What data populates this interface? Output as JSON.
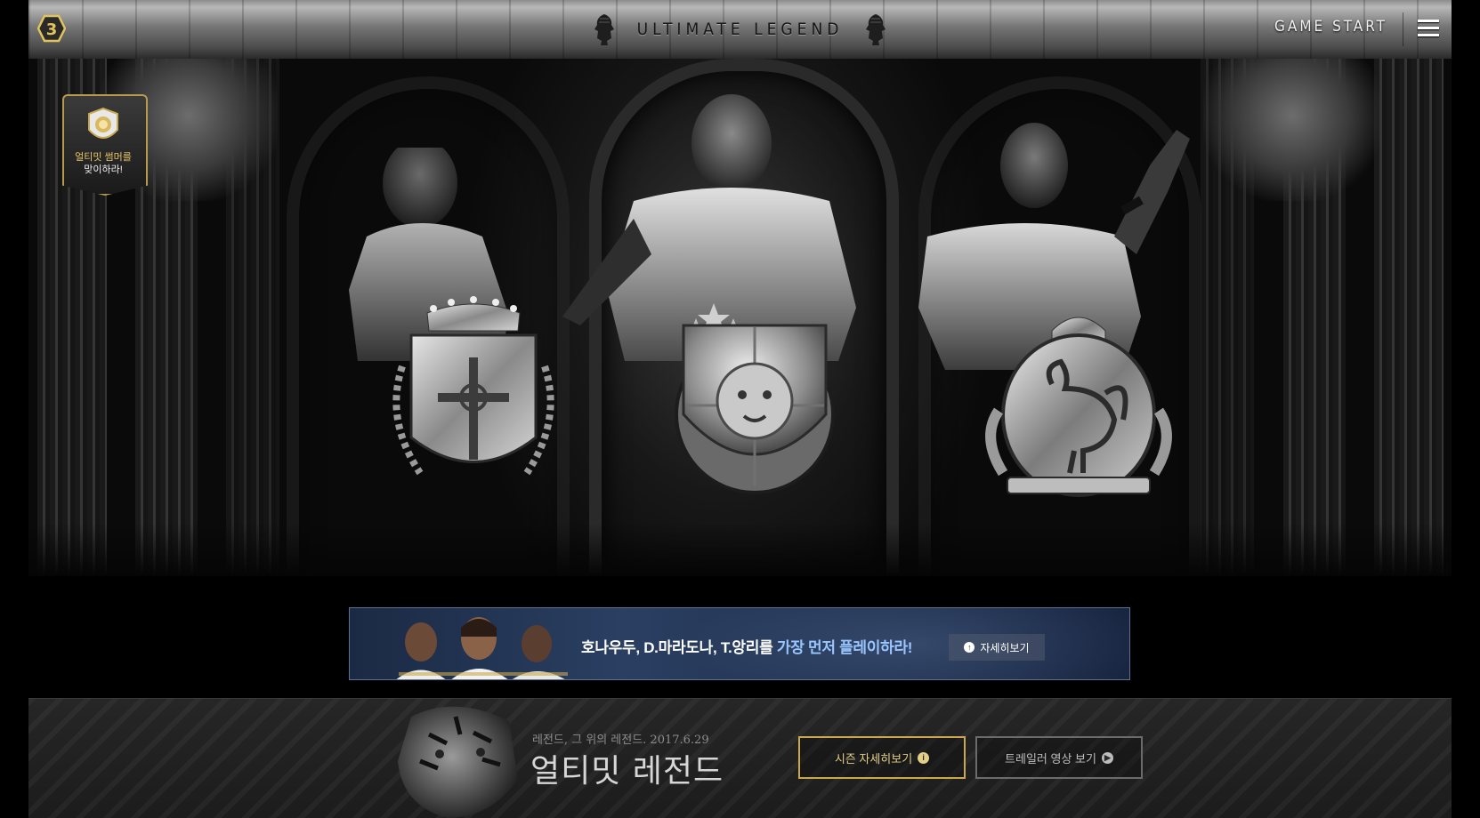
{
  "header": {
    "badge_number": "3",
    "title": "ULTIMATE LEGEND",
    "game_start_label": "GAME START"
  },
  "sticker": {
    "line1": "얼티밋 썸머를",
    "line2": "맞이하라!"
  },
  "banner": {
    "text_main": "호나우두, D.마라도나, T.앙리를 ",
    "text_highlight": "가장 먼저 플레이하라!",
    "button_label": "자세히보기"
  },
  "footer": {
    "tagline": "레전드, 그 위의 레전드. 2017.6.29",
    "title": "얼티밋 레전드",
    "season_button_label": "시즌 자세히보기",
    "trailer_button_label": "트레일러 영상 보기"
  },
  "colors": {
    "gold": "#c9a84f",
    "banner_blue": "#2a3f62",
    "highlight_blue": "#9ac6ff"
  }
}
